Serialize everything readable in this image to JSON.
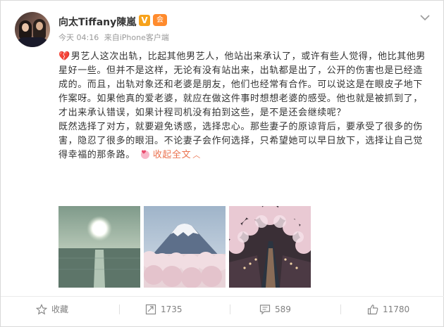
{
  "user": {
    "name": "向太Tiffany陳嵐",
    "verified_badge": "V",
    "vip_badge": "会"
  },
  "meta": {
    "time": "今天 04:16",
    "source_prefix": "来自",
    "source": "iPhone客户端"
  },
  "post": {
    "paragraph1": "男艺人这次出轨，比起其他男艺人，他站出来承认了，或许有些人觉得，他比其他男星好一些。但并不是这样，无论有没有站出来，出轨都是出了，公开的伤害也是已经造成的。而且，出轨对象还和老婆是朋友，他们也经常有合作。可以说这是在眼皮子地下作案呀。如果他真的爱老婆，就应在做这件事时想想老婆的感受。他也就是被抓到了，才出来承认错误，如果计程司机没有拍到这些，是不是还会继续呢？",
    "paragraph2": "既然选择了对方，就要避免诱惑，选择忠心。那些妻子的原谅背后，要承受了很多的伤害，隐忍了很多的眼泪。不论妻子会作何选择，只希望她可以早日放下，选择让自己觉得幸福的那条路。",
    "collapse_label": "收起全文",
    "heart_icon": "broken-heart-icon",
    "emoji_icon": "heart-face-emoji"
  },
  "actions": {
    "favorite_label": "收藏",
    "repost_count": "1735",
    "comment_count": "589",
    "like_count": "11780"
  },
  "colors": {
    "link": "#eb7350",
    "meta": "#999999",
    "vbadge": "#f7a21b",
    "vipbadge": "#ff8b2d"
  }
}
